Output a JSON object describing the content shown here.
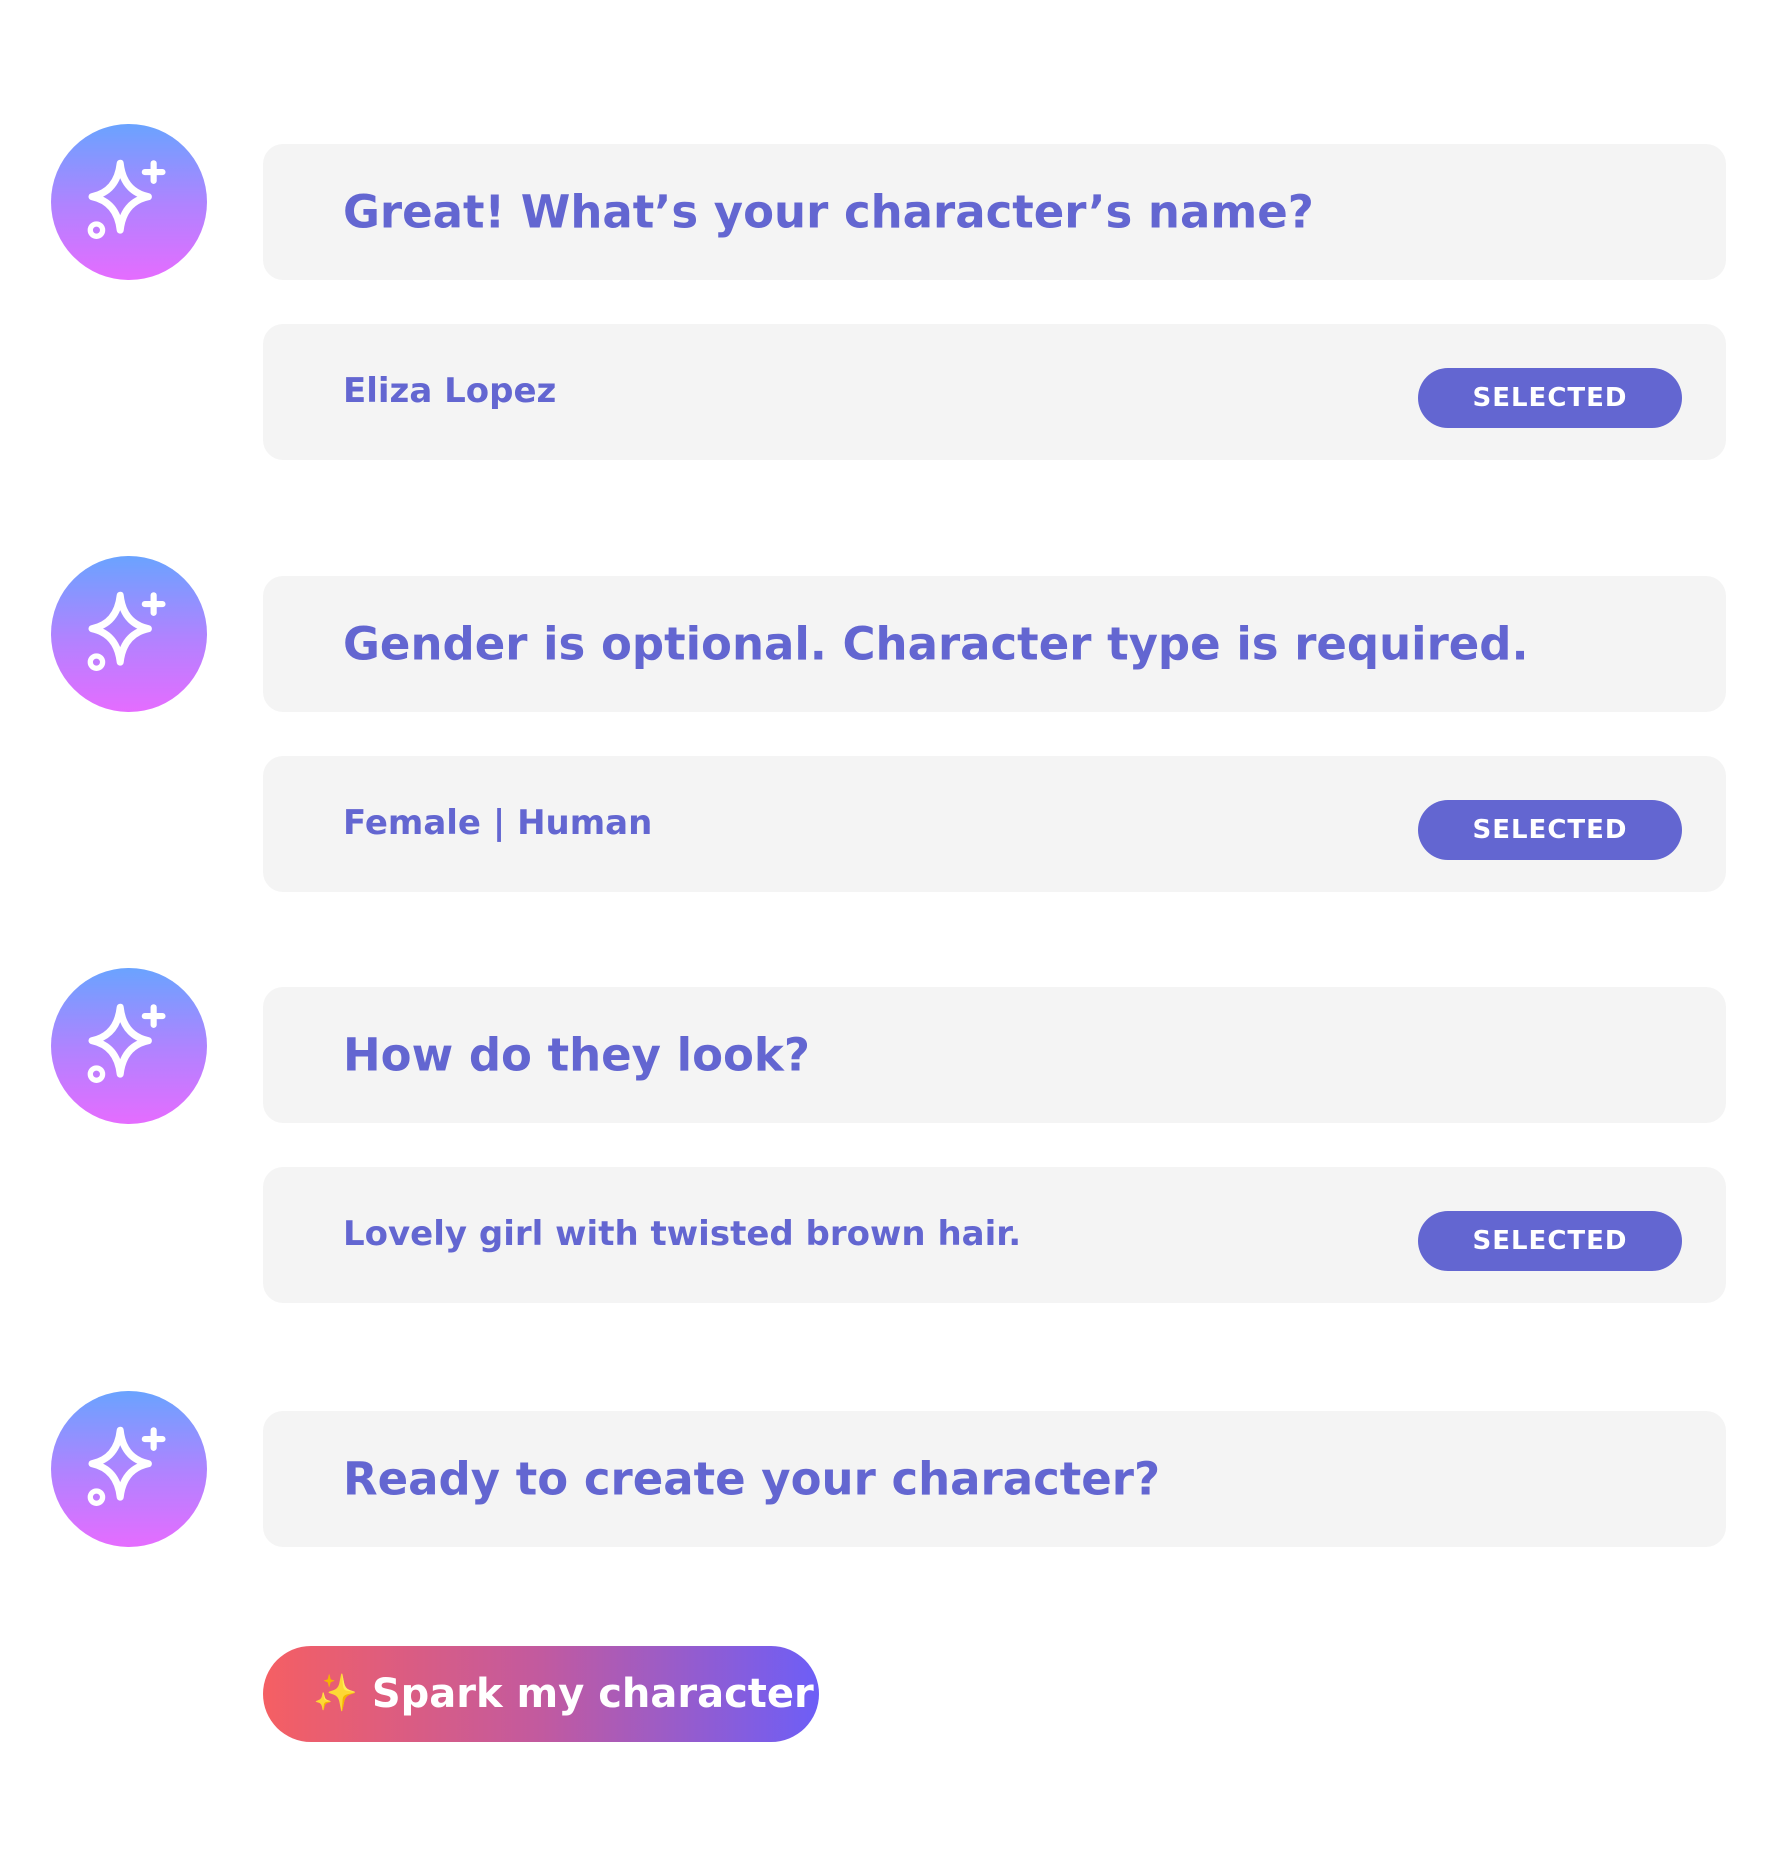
{
  "conversation": {
    "steps": [
      {
        "question": "Great! What’s your character’s name?",
        "answer": "Eliza Lopez",
        "status": "SELECTED"
      },
      {
        "question": "Gender is  optional. Character type is required.",
        "answer": "Female | Human",
        "status": "SELECTED"
      },
      {
        "question": "How do they look?",
        "answer": "Lovely girl with twisted brown hair.",
        "status": "SELECTED"
      },
      {
        "question": "Ready to create your character?"
      }
    ]
  },
  "cta": {
    "icon": "sparkles-icon",
    "label": "Spark my character"
  },
  "colors": {
    "accent": "#6366d1",
    "bubble": "#f4f4f4",
    "avatar_gradient_top": "#6aa3ff",
    "avatar_gradient_bottom": "#e56cff",
    "cta_gradient_start": "#f55f63",
    "cta_gradient_end": "#6d5ef7"
  }
}
